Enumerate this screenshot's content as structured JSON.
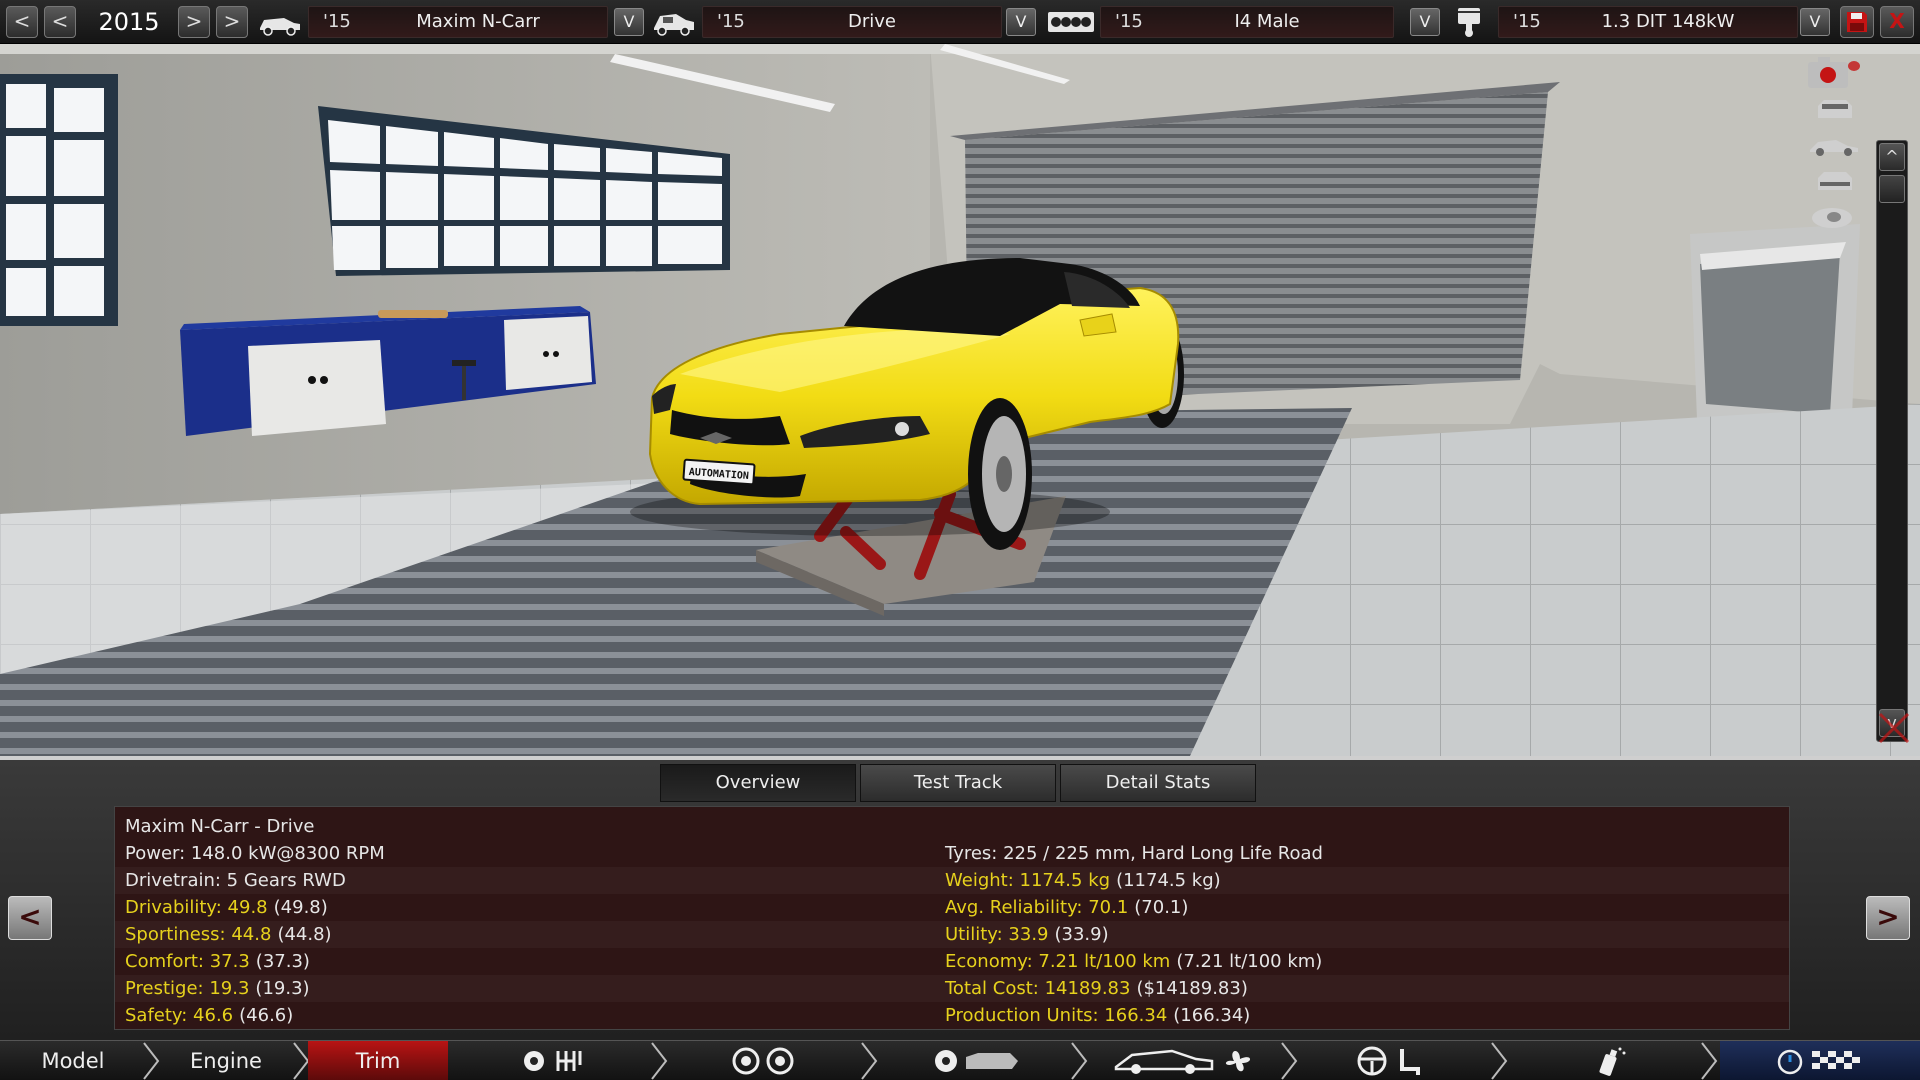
{
  "topbar": {
    "year": "2015",
    "prev_fast": "<",
    "prev": "<",
    "next": ">",
    "next_fast": ">",
    "dropdown_glyph": "V",
    "selectors": [
      {
        "icon": "car-model-icon",
        "year": "'15",
        "name": "Maxim N-Carr"
      },
      {
        "icon": "car-trim-icon",
        "year": "'15",
        "name": "Drive"
      },
      {
        "icon": "engine-block-icon",
        "year": "'15",
        "name": "I4 Male"
      },
      {
        "icon": "piston-icon",
        "year": "'15",
        "name": "1.3 DIT 148kW"
      }
    ],
    "save_icon": "floppy-disk-icon",
    "close_label": "X"
  },
  "right_toolbar": {
    "icons": [
      "camera-icon",
      "car-front-view-icon",
      "car-side-view-icon",
      "car-rear-view-icon",
      "car-top-view-icon"
    ],
    "scroll_up": "^",
    "scroll_down": "v"
  },
  "tabs": [
    "Overview",
    "Test Track",
    "Detail Stats"
  ],
  "active_tab": "Overview",
  "overview": {
    "title": "Maxim N-Carr - Drive",
    "left": [
      {
        "label": "Power: 148.0 kW@8300 RPM",
        "paren": "",
        "highlight": false
      },
      {
        "label": "Drivetrain: 5 Gears RWD",
        "paren": "",
        "highlight": false
      },
      {
        "label": "Drivability: 49.8",
        "paren": "(49.8)",
        "highlight": true
      },
      {
        "label": "Sportiness: 44.8",
        "paren": "(44.8)",
        "highlight": true
      },
      {
        "label": "Comfort: 37.3",
        "paren": "(37.3)",
        "highlight": true
      },
      {
        "label": "Prestige: 19.3",
        "paren": "(19.3)",
        "highlight": true
      },
      {
        "label": "Safety: 46.6",
        "paren": "(46.6)",
        "highlight": true
      }
    ],
    "right": [
      {
        "label": "Tyres: 225 / 225 mm, Hard Long Life Road",
        "paren": "",
        "highlight": false
      },
      {
        "label": "Weight: 1174.5 kg",
        "paren": "(1174.5 kg)",
        "highlight": true
      },
      {
        "label": "Avg. Reliability: 70.1",
        "paren": "(70.1)",
        "highlight": true
      },
      {
        "label": "Utility: 33.9",
        "paren": "(33.9)",
        "highlight": true
      },
      {
        "label": "Economy: 7.21 lt/100 km",
        "paren": "(7.21 lt/100 km)",
        "highlight": true
      },
      {
        "label": "Total Cost: 14189.83",
        "paren": "($14189.83)",
        "highlight": true
      },
      {
        "label": "Production Units: 166.34",
        "paren": "(166.34)",
        "highlight": true
      }
    ]
  },
  "side_nav": {
    "prev": "<",
    "next": ">"
  },
  "scene": {
    "plate_text": "AUTOMATION",
    "car_color": "#f2dc14"
  },
  "bottom_nav": {
    "items": [
      "Model",
      "Engine",
      "Trim"
    ],
    "active": "Trim",
    "icon_groups": [
      [
        "gear-icon",
        "gearbox-icon"
      ],
      [
        "wheel-icon",
        "wheel-icon"
      ],
      [
        "brake-disc-icon",
        "car-body-icon"
      ],
      [
        "car-icon",
        "fan-icon"
      ],
      [
        "steering-wheel-icon",
        "seat-icon"
      ],
      [
        "spray-can-icon"
      ],
      [
        "stopwatch-icon",
        "checkered-flag-icon"
      ]
    ]
  },
  "colors": {
    "accent_red": "#b81414",
    "highlight_yellow": "#e6d11d",
    "panel_bg": "#2e1515"
  }
}
